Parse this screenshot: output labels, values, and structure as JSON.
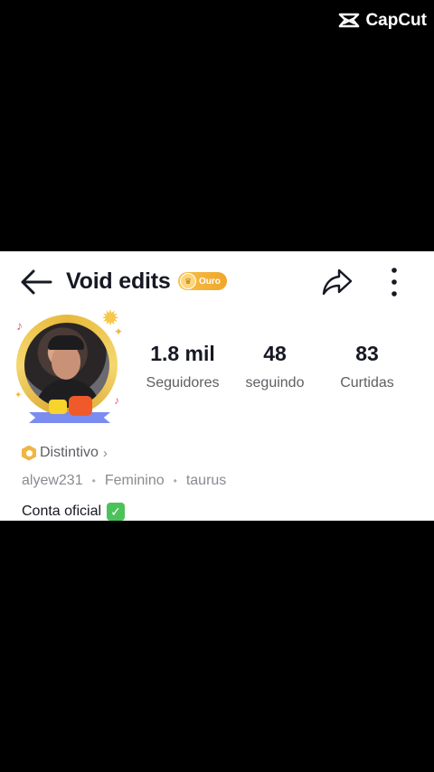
{
  "watermark": {
    "text": "CapCut"
  },
  "header": {
    "title": "Void edits",
    "badge_label": "Ouro",
    "back_icon": "arrow-left-icon",
    "share_icon": "share-icon",
    "more_icon": "more-vertical-icon"
  },
  "stats": [
    {
      "value": "1.8 mil",
      "label": "Seguidores"
    },
    {
      "value": "48",
      "label": "seguindo"
    },
    {
      "value": "83",
      "label": "Curtidas"
    }
  ],
  "distintivo": {
    "label": "Distintivo",
    "icon": "badge-hex-icon"
  },
  "meta": {
    "username": "alyew231",
    "gender": "Feminino",
    "sign": "taurus"
  },
  "bio": {
    "text": "Conta oficial",
    "emoji_icon": "check-mark-button-icon",
    "emoji_glyph": "✓"
  },
  "colors": {
    "badge_gold": "#f0a62a",
    "check_green": "#4cc35a",
    "text_primary": "#161823",
    "text_secondary": "#5e5f64"
  }
}
